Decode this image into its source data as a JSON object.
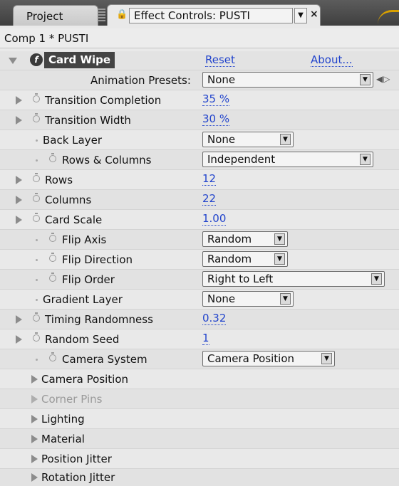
{
  "tabs": {
    "project_label": "Project",
    "effect_controls_label": "Effect Controls: PUSTI",
    "close_glyph": "×"
  },
  "comp_label": "Comp 1 * PUSTI",
  "effect": {
    "fx_glyph": "f",
    "name": "Card Wipe",
    "reset_label": "Reset",
    "about_label": "About..."
  },
  "presets": {
    "label": "Animation Presets:",
    "value": "None"
  },
  "properties": {
    "transition_completion": {
      "label": "Transition Completion",
      "value": "35 %"
    },
    "transition_width": {
      "label": "Transition Width",
      "value": "30 %"
    },
    "back_layer": {
      "label": "Back Layer",
      "value": "None"
    },
    "rows_columns": {
      "label": "Rows & Columns",
      "value": "Independent"
    },
    "rows": {
      "label": "Rows",
      "value": "12"
    },
    "columns": {
      "label": "Columns",
      "value": "22"
    },
    "card_scale": {
      "label": "Card Scale",
      "value": "1.00"
    },
    "flip_axis": {
      "label": "Flip Axis",
      "value": "Random"
    },
    "flip_direction": {
      "label": "Flip Direction",
      "value": "Random"
    },
    "flip_order": {
      "label": "Flip Order",
      "value": "Right to Left"
    },
    "gradient_layer": {
      "label": "Gradient Layer",
      "value": "None"
    },
    "timing_randomness": {
      "label": "Timing Randomness",
      "value": "0.32"
    },
    "random_seed": {
      "label": "Random Seed",
      "value": "1"
    },
    "camera_system": {
      "label": "Camera System",
      "value": "Camera Position"
    }
  },
  "groups": {
    "camera_position": "Camera Position",
    "corner_pins": "Corner Pins",
    "lighting": "Lighting",
    "material": "Material",
    "position_jitter": "Position Jitter",
    "rotation_jitter": "Rotation Jitter"
  },
  "colors": {
    "link": "#2244cc",
    "tab_accent": "#d8a000"
  }
}
